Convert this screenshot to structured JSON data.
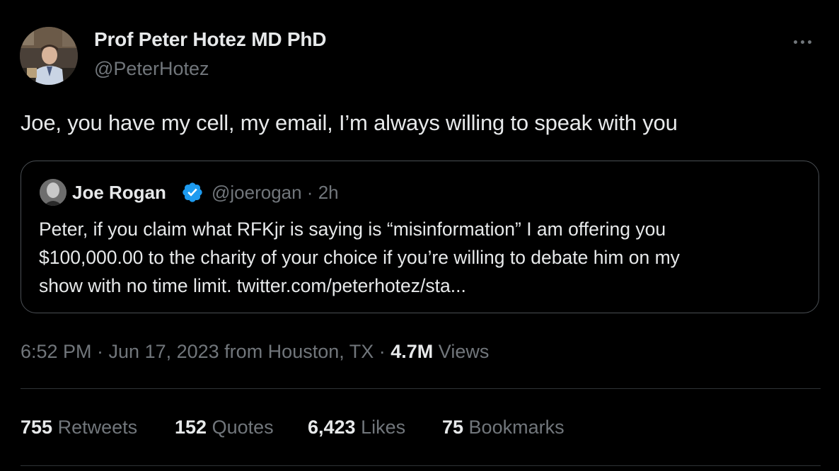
{
  "author": {
    "name": "Prof Peter Hotez MD PhD",
    "handle": "@PeterHotez"
  },
  "tweet_text": "Joe, you have my cell, my email, I’m always willing to speak with you",
  "quoted_tweet": {
    "name": "Joe Rogan",
    "verified": true,
    "handle_time": "@joerogan · 2h",
    "text_lines": [
      "Peter, if you claim what RFKjr is saying is “misinformation” I am offering you",
      "$100,000.00 to the charity of your choice if you’re willing to debate him on my",
      "show with no time limit. twitter.com/peterhotez/sta..."
    ]
  },
  "meta": {
    "timestamp": "6:52 PM · Jun 17, 2023 from Houston, TX · ",
    "views_count": "4.7M",
    "views_label": " Views"
  },
  "stats": {
    "retweets_count": "755",
    "retweets_label": " Retweets",
    "quotes_count": "152",
    "quotes_label": " Quotes",
    "likes_count": "6,423",
    "likes_label": " Likes",
    "bookmarks_count": "75",
    "bookmarks_label": " Bookmarks"
  },
  "icons": {
    "more": "more-horizontal-icon",
    "verified": "verified-badge-icon"
  },
  "colors": {
    "background": "#000000",
    "primary_text": "#e7e9ea",
    "secondary_text": "#71767b",
    "border": "#2f3336",
    "verified_blue": "#1d9bf0"
  }
}
